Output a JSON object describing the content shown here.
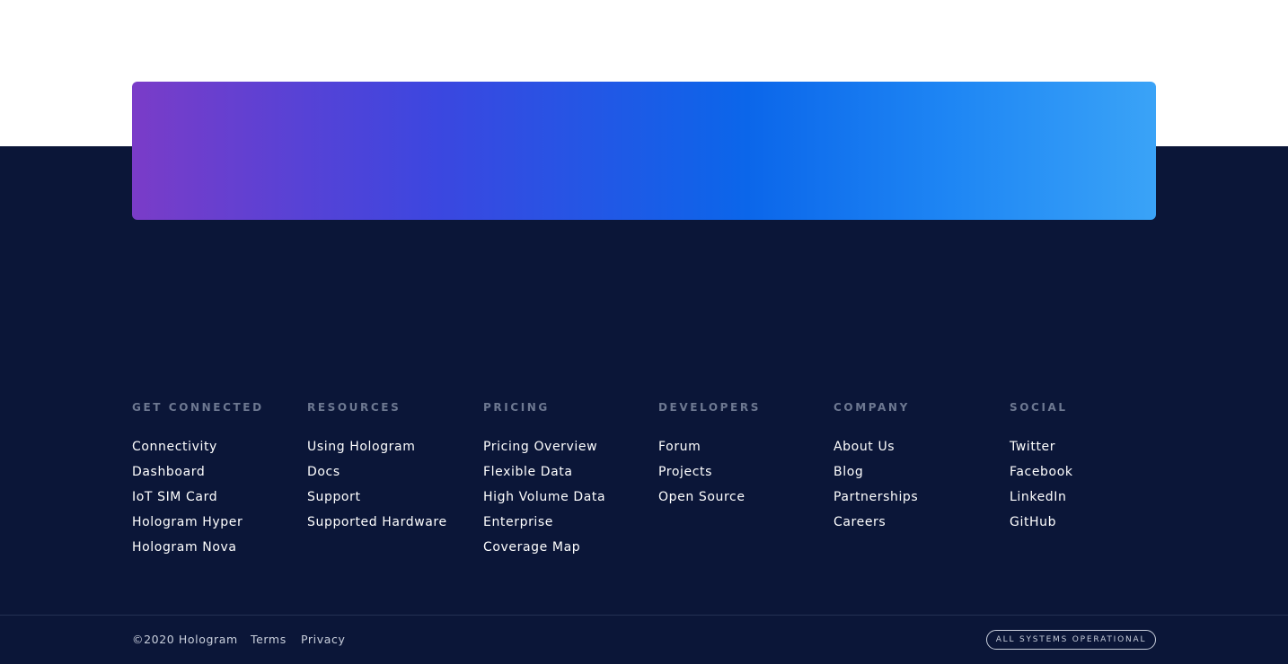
{
  "colors": {
    "footer_background": "#0b1638",
    "gradient_start": "#7a3cc8",
    "gradient_mid": "#0b66ea",
    "gradient_end": "#3aa3f7",
    "heading_text": "#6d7891",
    "link_text": "#ffffff"
  },
  "footer": {
    "columns": [
      {
        "heading": "GET CONNECTED",
        "links": [
          "Connectivity",
          "Dashboard",
          "IoT SIM Card",
          "Hologram Hyper",
          "Hologram Nova"
        ]
      },
      {
        "heading": "RESOURCES",
        "links": [
          "Using Hologram",
          "Docs",
          "Support",
          "Supported Hardware"
        ]
      },
      {
        "heading": "PRICING",
        "links": [
          "Pricing Overview",
          "Flexible Data",
          "High Volume Data",
          "Enterprise",
          "Coverage Map"
        ]
      },
      {
        "heading": "DEVELOPERS",
        "links": [
          "Forum",
          "Projects",
          "Open Source"
        ]
      },
      {
        "heading": "COMPANY",
        "links": [
          "About Us",
          "Blog",
          "Partnerships",
          "Careers"
        ]
      },
      {
        "heading": "SOCIAL",
        "links": [
          "Twitter",
          "Facebook",
          "LinkedIn",
          "GitHub"
        ]
      }
    ]
  },
  "bottom_bar": {
    "copyright": "©2020 Hologram",
    "terms": "Terms",
    "privacy": "Privacy",
    "status": "ALL SYSTEMS OPERATIONAL"
  }
}
